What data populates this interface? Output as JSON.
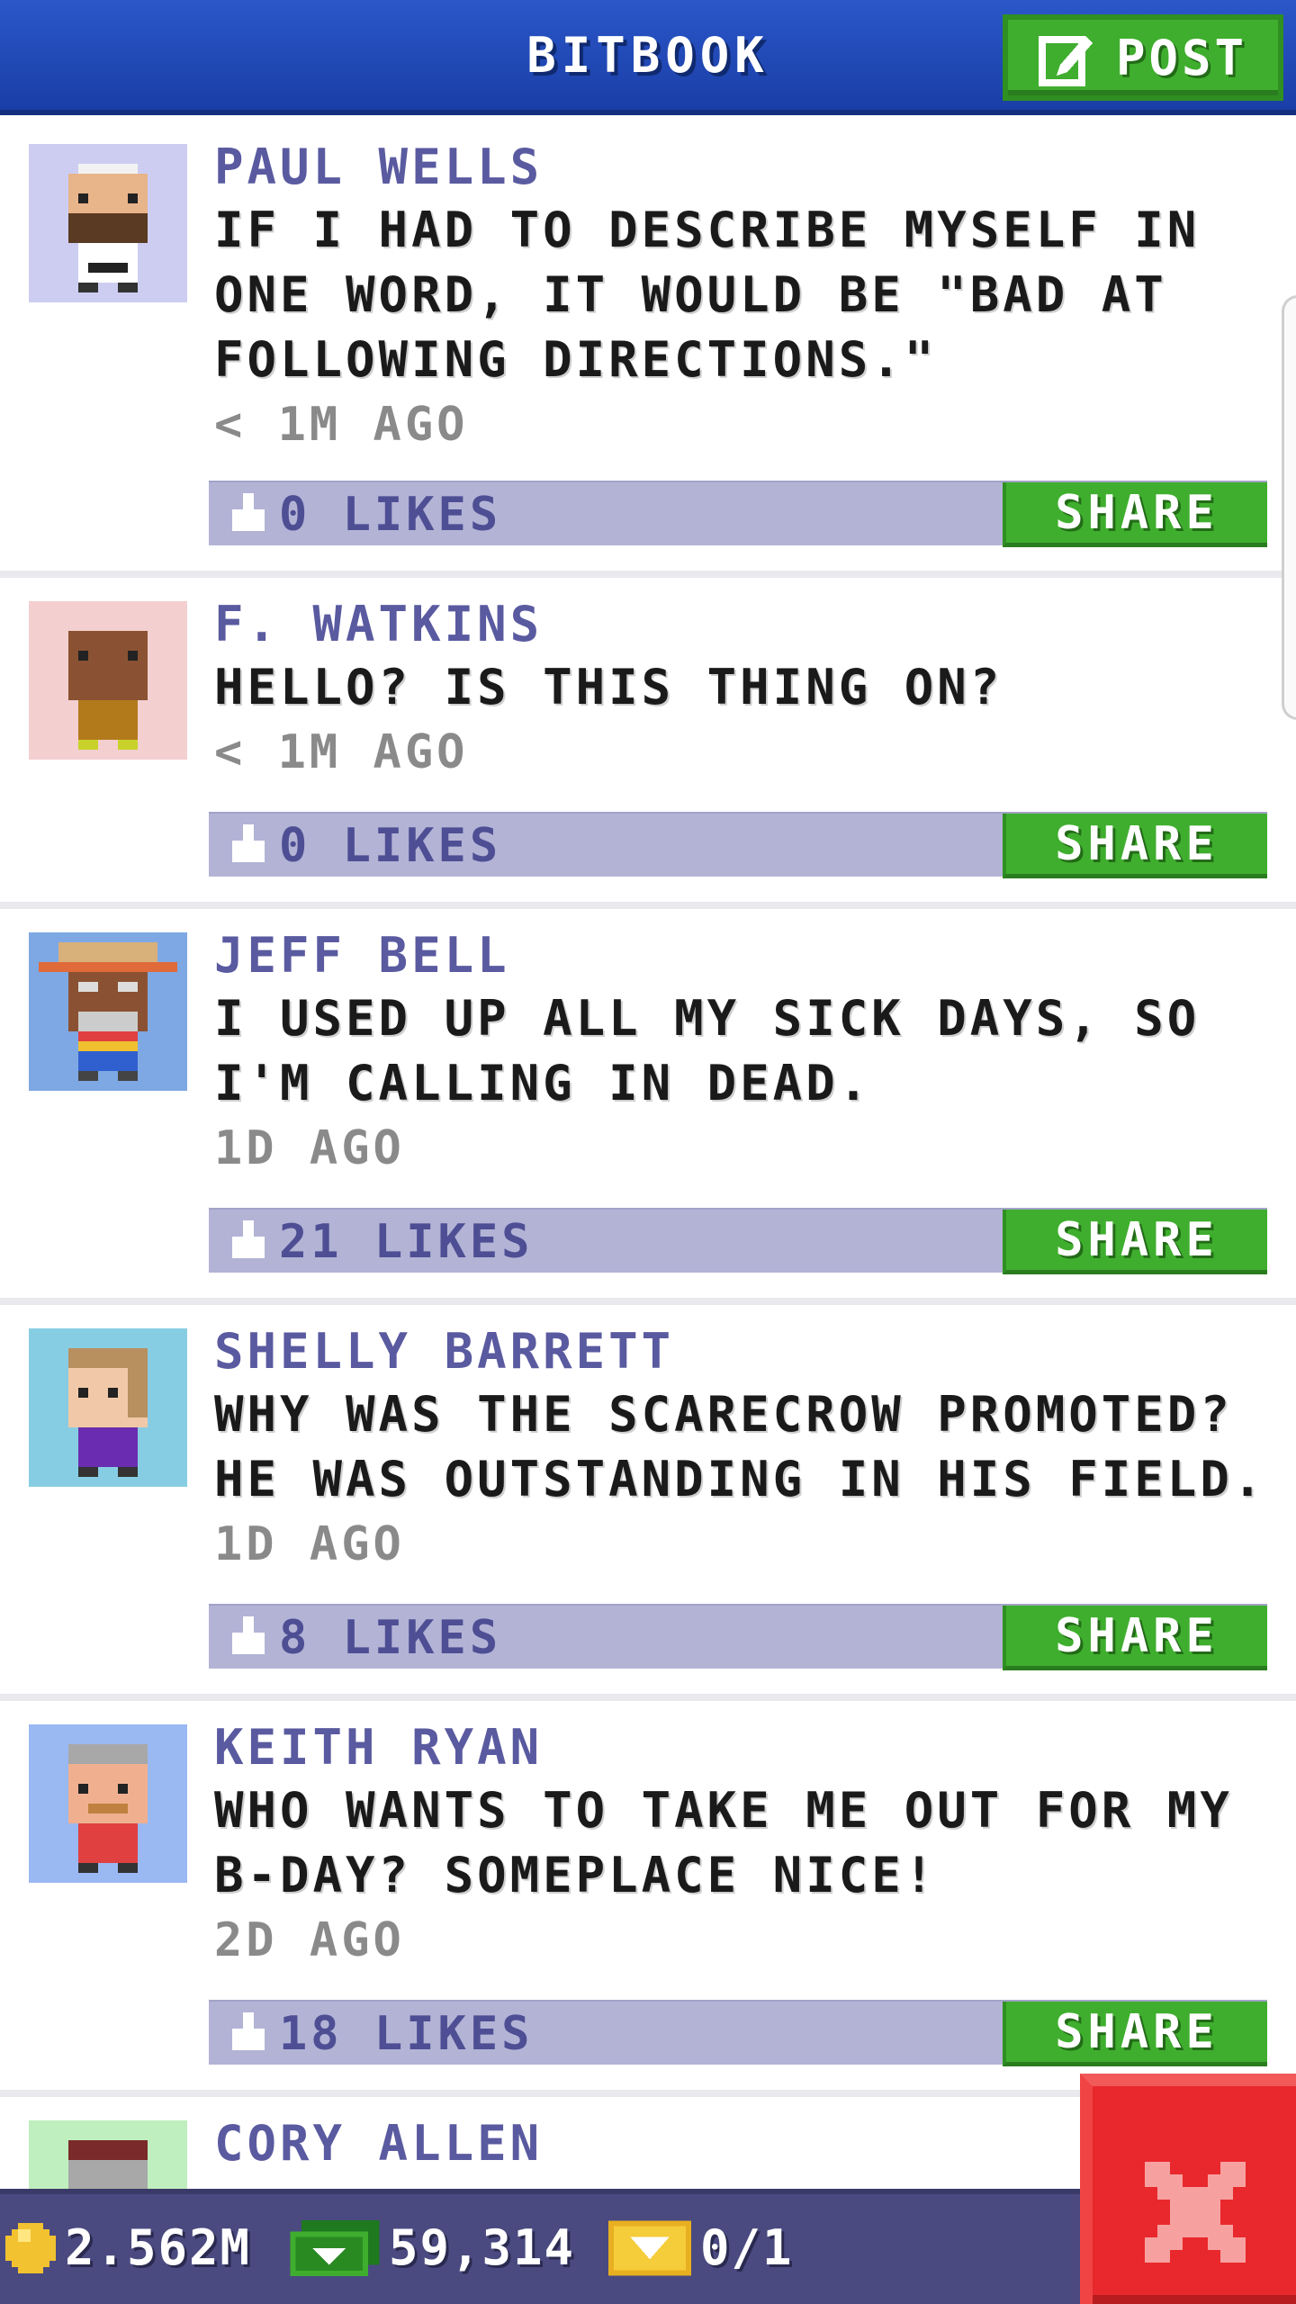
{
  "header": {
    "title": "BITBOOK",
    "post_label": "POST"
  },
  "posts": [
    {
      "author": "PAUL WELLS",
      "message": "IF I HAD TO DESCRIBE MYSELF IN ONE WORD, IT WOULD BE \"BAD AT FOLLOWING DIRECTIONS.\"",
      "time": "< 1M AGO",
      "likes": "0 LIKES",
      "share": "SHARE",
      "avatar_bg": "#cdcdf2"
    },
    {
      "author": "F. WATKINS",
      "message": "HELLO? IS THIS THING ON?",
      "time": "< 1M AGO",
      "likes": "0 LIKES",
      "share": "SHARE",
      "avatar_bg": "#f3cfd0"
    },
    {
      "author": "JEFF BELL",
      "message": "I USED UP ALL MY SICK DAYS, SO I'M CALLING IN DEAD.",
      "time": "1D AGO",
      "likes": "21 LIKES",
      "share": "SHARE",
      "avatar_bg": "#7ea8e4"
    },
    {
      "author": "SHELLY BARRETT",
      "message": "WHY WAS THE SCARECROW PROMOTED? HE WAS OUTSTANDING IN HIS FIELD.",
      "time": "1D AGO",
      "likes": "8 LIKES",
      "share": "SHARE",
      "avatar_bg": "#86cde3"
    },
    {
      "author": "KEITH RYAN",
      "message": "WHO WANTS TO TAKE ME OUT FOR MY B-DAY? SOMEPLACE NICE!",
      "time": "2D AGO",
      "likes": "18 LIKES",
      "share": "SHARE",
      "avatar_bg": "#9ab8f2"
    },
    {
      "author": "CORY ALLEN",
      "avatar_bg": "#bfefbf"
    }
  ],
  "status": {
    "coins": "2.562M",
    "bux": "59,314",
    "tickets": "0/1"
  }
}
